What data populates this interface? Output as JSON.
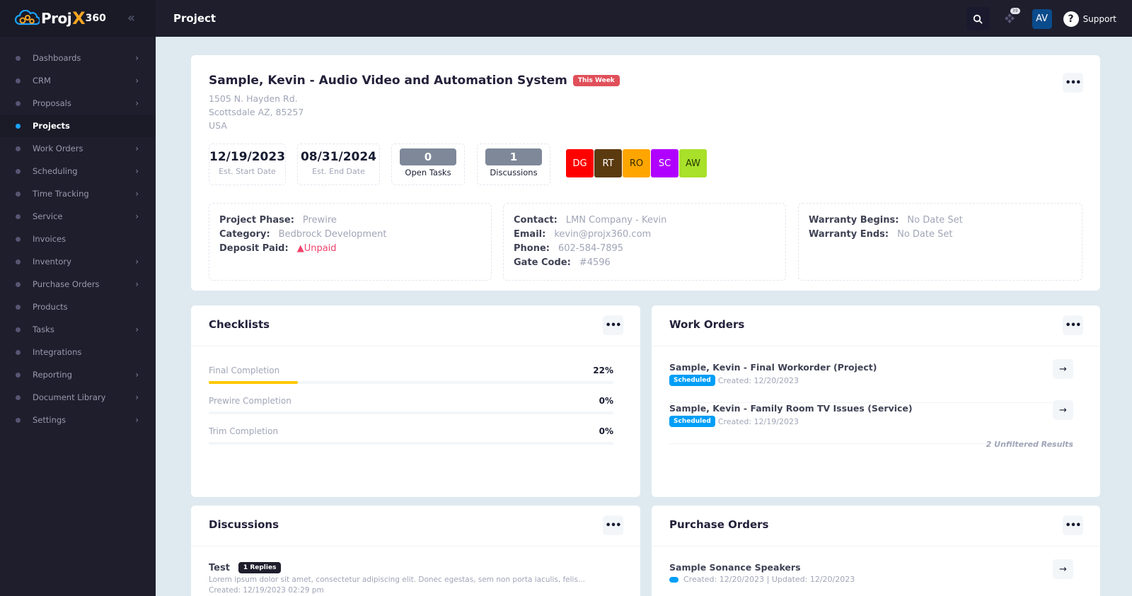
{
  "app": {
    "logo_text": "Proj",
    "logo_x": "X",
    "logo_num": "360",
    "collapse_icon": "double-chevron-left"
  },
  "header": {
    "title": "Project",
    "notifications_count": "39",
    "avatar_initials": "AV",
    "support_label": "Support"
  },
  "sidebar": {
    "items": [
      {
        "label": "Dashboards",
        "has_children": true,
        "active": false
      },
      {
        "label": "CRM",
        "has_children": true,
        "active": false
      },
      {
        "label": "Proposals",
        "has_children": true,
        "active": false
      },
      {
        "label": "Projects",
        "has_children": false,
        "active": true
      },
      {
        "label": "Work Orders",
        "has_children": true,
        "active": false
      },
      {
        "label": "Scheduling",
        "has_children": true,
        "active": false
      },
      {
        "label": "Time Tracking",
        "has_children": true,
        "active": false
      },
      {
        "label": "Service",
        "has_children": true,
        "active": false
      },
      {
        "label": "Invoices",
        "has_children": false,
        "active": false
      },
      {
        "label": "Inventory",
        "has_children": true,
        "active": false
      },
      {
        "label": "Purchase Orders",
        "has_children": true,
        "active": false
      },
      {
        "label": "Products",
        "has_children": false,
        "active": false
      },
      {
        "label": "Tasks",
        "has_children": true,
        "active": false
      },
      {
        "label": "Integrations",
        "has_children": false,
        "active": false
      },
      {
        "label": "Reporting",
        "has_children": true,
        "active": false
      },
      {
        "label": "Document Library",
        "has_children": true,
        "active": false
      },
      {
        "label": "Settings",
        "has_children": true,
        "active": false
      }
    ]
  },
  "project": {
    "title": "Sample, Kevin - Audio Video and Automation System",
    "badge": "This Week",
    "address": {
      "line1": "1505 N. Hayden Rd.",
      "line2": "Scottsdale AZ, 85257",
      "line3": "USA"
    },
    "stats": {
      "start_date": "12/19/2023",
      "start_label": "Est. Start Date",
      "end_date": "08/31/2024",
      "end_label": "Est. End Date",
      "open_tasks": "0",
      "open_tasks_label": "Open Tasks",
      "discussions": "1",
      "discussions_label": "Discussions"
    },
    "team": [
      {
        "initials": "DG",
        "bg": "#ff0000",
        "fg": "#ffffff"
      },
      {
        "initials": "RT",
        "bg": "#5c3a10",
        "fg": "#ffffff"
      },
      {
        "initials": "RO",
        "bg": "#ffa500",
        "fg": "#3a2a00"
      },
      {
        "initials": "SC",
        "bg": "#b000ff",
        "fg": "#ffffff"
      },
      {
        "initials": "AW",
        "bg": "#a8e02a",
        "fg": "#2a3a00"
      }
    ],
    "details": {
      "phase_label": "Project Phase:",
      "phase": "Prewire",
      "category_label": "Category:",
      "category": "Bedbrock Development",
      "deposit_label": "Deposit Paid:",
      "deposit": "Unpaid"
    },
    "contact": {
      "contact_label": "Contact:",
      "contact": "LMN Company - Kevin",
      "email_label": "Email:",
      "email": "kevin@projx360.com",
      "phone_label": "Phone:",
      "phone": "602-584-7895",
      "gate_label": "Gate Code:",
      "gate": "#4596"
    },
    "warranty": {
      "begins_label": "Warranty Begins:",
      "begins": "No Date Set",
      "ends_label": "Warranty Ends:",
      "ends": "No Date Set"
    }
  },
  "checklists": {
    "title": "Checklists",
    "items": [
      {
        "label": "Final Completion",
        "percent_label": "22%",
        "percent": 22
      },
      {
        "label": "Prewire Completion",
        "percent_label": "0%",
        "percent": 0
      },
      {
        "label": "Trim Completion",
        "percent_label": "0%",
        "percent": 0
      }
    ]
  },
  "work_orders": {
    "title": "Work Orders",
    "items": [
      {
        "title": "Sample, Kevin - Final Workorder (Project)",
        "status": "Scheduled",
        "created": "Created: 12/20/2023"
      },
      {
        "title": "Sample, Kevin - Family Room TV Issues (Service)",
        "status": "Scheduled",
        "created": "Created: 12/19/2023"
      }
    ],
    "results_note": "2 Unfiltered Results"
  },
  "discussions": {
    "title": "Discussions",
    "items": [
      {
        "title": "Test",
        "replies": "1 Replies",
        "excerpt": "Lorem ipsum dolor sit amet, consectetur adipiscing elit. Donec egestas, sem non porta iaculis, felis...",
        "created": "Created: 12/19/2023 02:29 pm"
      }
    ]
  },
  "purchase_orders": {
    "title": "Purchase Orders",
    "items": [
      {
        "title": "Sample Sonance Speakers",
        "meta": "Created: 12/20/2023 | Updated: 12/20/2023"
      }
    ]
  }
}
